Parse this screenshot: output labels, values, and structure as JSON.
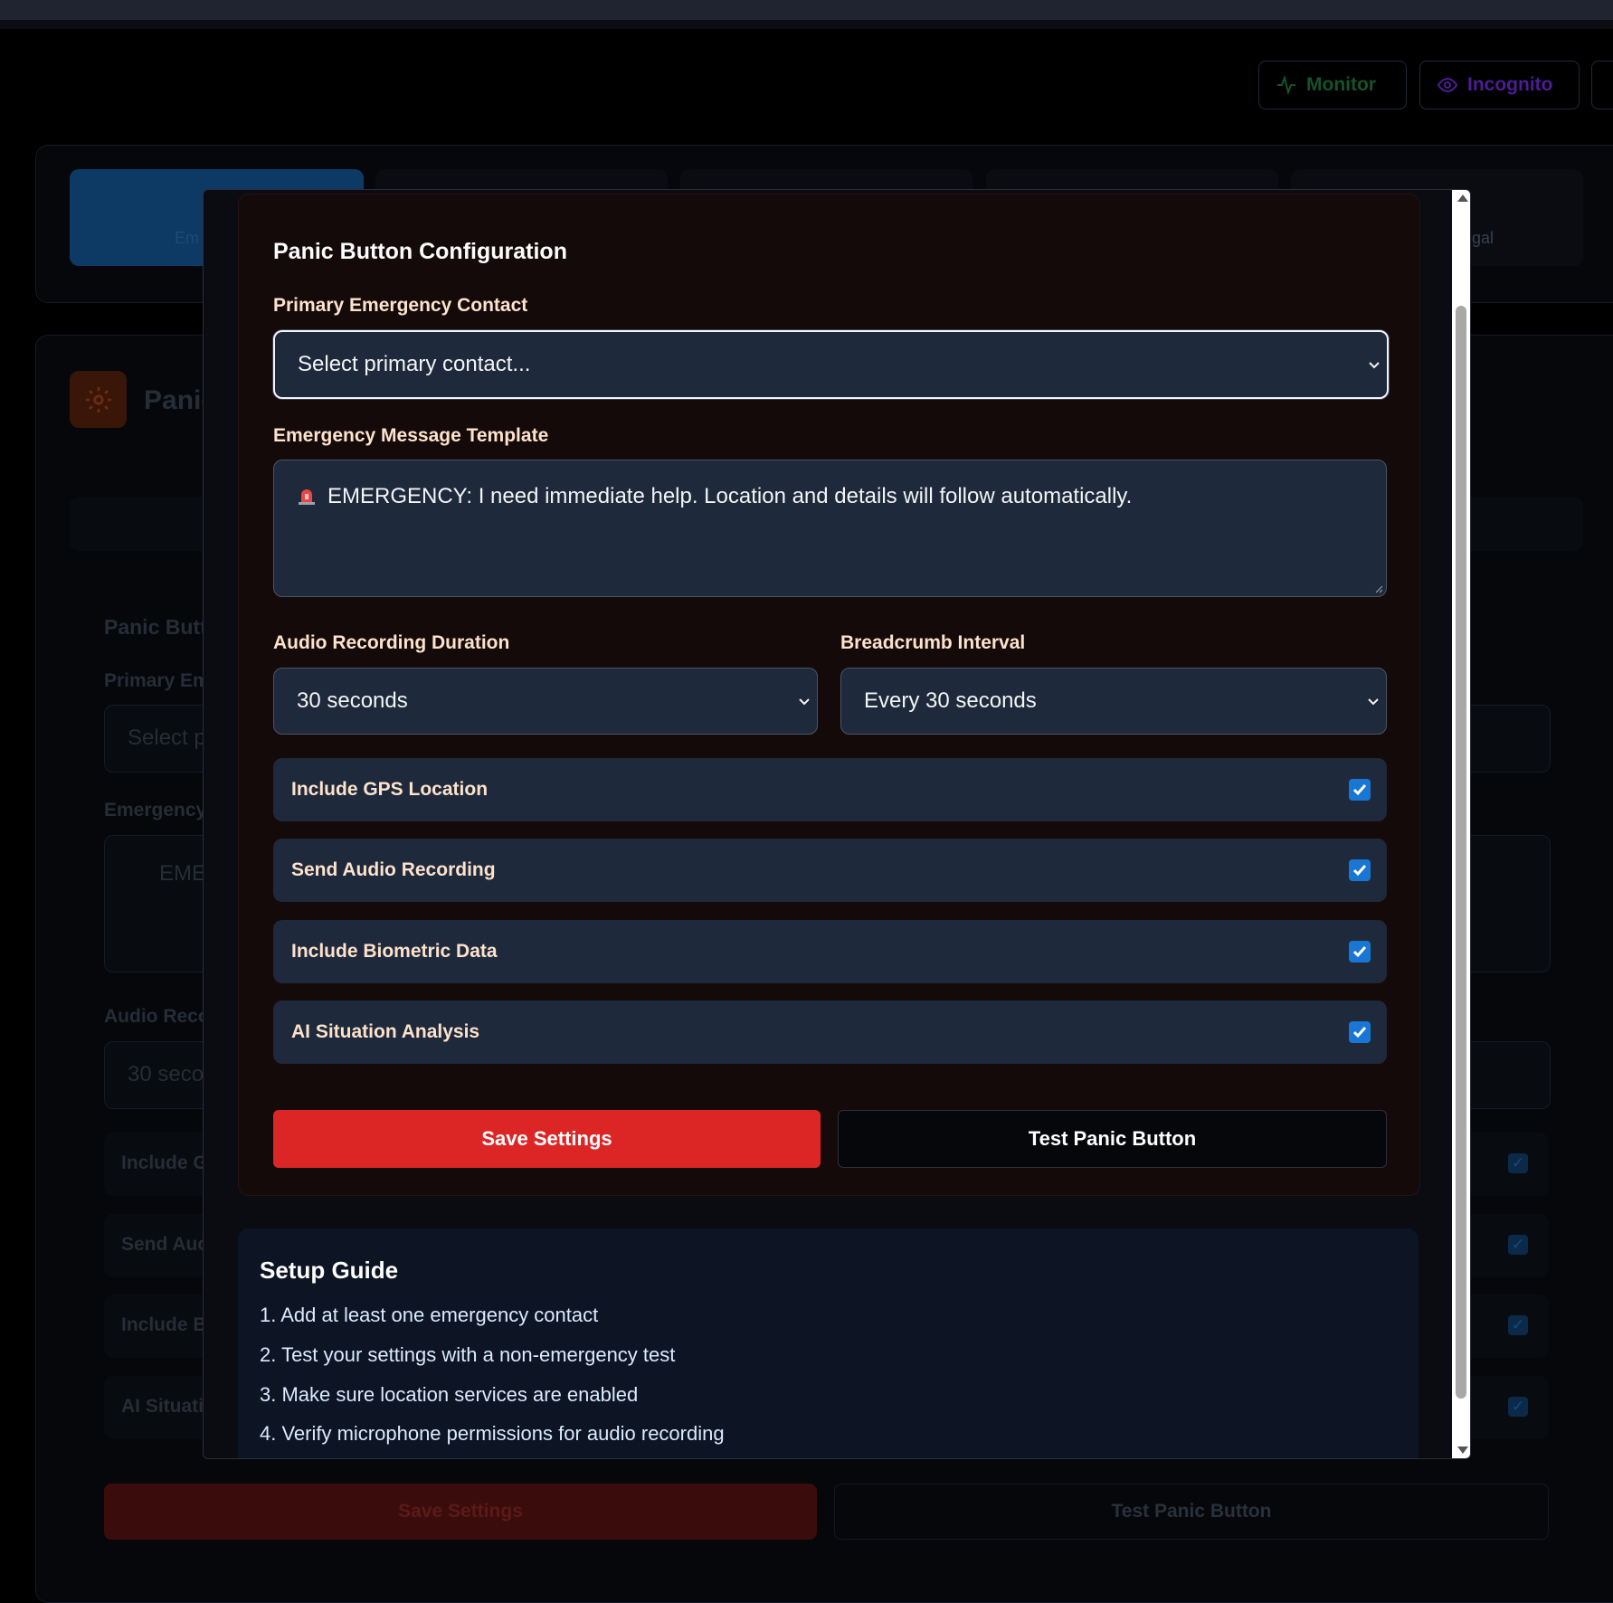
{
  "header": {
    "monitor_label": "Monitor",
    "incognito_label": "Incognito"
  },
  "background": {
    "tabs": [
      {
        "label": "Em"
      },
      {
        "label": ""
      },
      {
        "label": ""
      },
      {
        "label": ""
      },
      {
        "label": "egal"
      }
    ],
    "panel_title": "Panic",
    "form_title": "Panic Butt",
    "primary_label": "Primary Em",
    "select_value": "Select p",
    "message_label": "Emergency",
    "message_value": "EME",
    "audio_label": "Audio Reco",
    "audio_value": "30 seco",
    "rows": [
      "Include G",
      "Send Auc",
      "Include B",
      "AI Situati"
    ],
    "save_label": "Save Settings",
    "test_label": "Test Panic Button"
  },
  "modal": {
    "title": "Panic Button Configuration",
    "primary_contact": {
      "label": "Primary Emergency Contact",
      "value": "Select primary contact..."
    },
    "message_template": {
      "label": "Emergency Message Template",
      "value": "EMERGENCY: I need immediate help. Location and details will follow automatically."
    },
    "audio_duration": {
      "label": "Audio Recording Duration",
      "value": "30 seconds"
    },
    "breadcrumb_interval": {
      "label": "Breadcrumb Interval",
      "value": "Every 30 seconds"
    },
    "toggles": [
      {
        "label": "Include GPS Location",
        "checked": true
      },
      {
        "label": "Send Audio Recording",
        "checked": true
      },
      {
        "label": "Include Biometric Data",
        "checked": true
      },
      {
        "label": "AI Situation Analysis",
        "checked": true
      }
    ],
    "save_label": "Save Settings",
    "test_label": "Test Panic Button"
  },
  "guide": {
    "title": "Setup Guide",
    "items": [
      "1. Add at least one emergency contact",
      "2. Test your settings with a non-emergency test",
      "3. Make sure location services are enabled",
      "4. Verify microphone permissions for audio recording"
    ]
  },
  "colors": {
    "accent_red": "#dc2626",
    "checkbox_blue": "#1976d2",
    "card_bg": "#150a0a",
    "field_bg": "#1e293b"
  }
}
